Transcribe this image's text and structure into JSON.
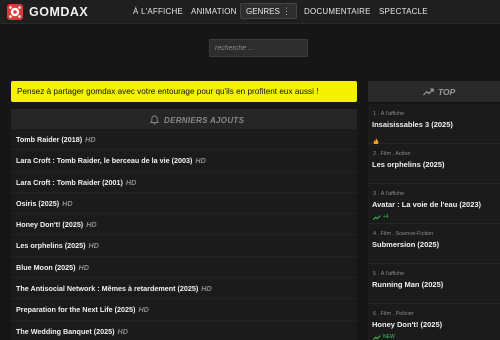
{
  "app": {
    "name": "GOMDAX"
  },
  "nav": {
    "items": [
      "À L'AFFICHE",
      "ANIMATION",
      "GENRES",
      "DOCUMENTAIRE",
      "SPECTACLE"
    ],
    "genres_more": "⋮"
  },
  "search": {
    "placeholder": "recherche ..."
  },
  "banner": {
    "text": "Pensez à partager gomdax avec votre entourage pour qu'ils en profitent eux aussi !"
  },
  "latest": {
    "title": "DERNIERS AJOUTS",
    "items": [
      {
        "title": "Tomb Raider (2018)",
        "quality": "HD"
      },
      {
        "title": "Lara Croft : Tomb Raider, le berceau de la vie (2003)",
        "quality": "HD"
      },
      {
        "title": "Lara Croft : Tomb Raider (2001)",
        "quality": "HD"
      },
      {
        "title": "Osiris (2025)",
        "quality": "HD"
      },
      {
        "title": "Honey Don't! (2025)",
        "quality": "HD"
      },
      {
        "title": "Les orphelins (2025)",
        "quality": "HD"
      },
      {
        "title": "Blue Moon (2025)",
        "quality": "HD"
      },
      {
        "title": "The Antisocial Network : Mêmes à retardement (2025)",
        "quality": "HD"
      },
      {
        "title": "Preparation for the Next Life (2025)",
        "quality": "HD"
      },
      {
        "title": "The Wedding Banquet (2025)",
        "quality": "HD"
      }
    ]
  },
  "top": {
    "title": "TOP",
    "items": [
      {
        "meta": "1 . À l'affiche",
        "title": "Insaisissables 3 (2025)",
        "badge": "fire"
      },
      {
        "meta": "2 . Film . Action",
        "title": "Les orphelins (2025)",
        "badge": ""
      },
      {
        "meta": "3 . À l'affiche",
        "title": "Avatar : La voie de l'eau (2023)",
        "badge": "+4"
      },
      {
        "meta": "4 . Film . Science-Fiction",
        "title": "Submersion (2025)",
        "badge": ""
      },
      {
        "meta": "5 . À l'affiche",
        "title": "Running Man (2025)",
        "badge": ""
      },
      {
        "meta": "6 . Film . Policier",
        "title": "Honey Don't! (2025)",
        "badge": "NEW"
      }
    ]
  },
  "colors": {
    "banner": "#f5f200",
    "background": "#161616",
    "trend_green": "#3cc45a"
  }
}
